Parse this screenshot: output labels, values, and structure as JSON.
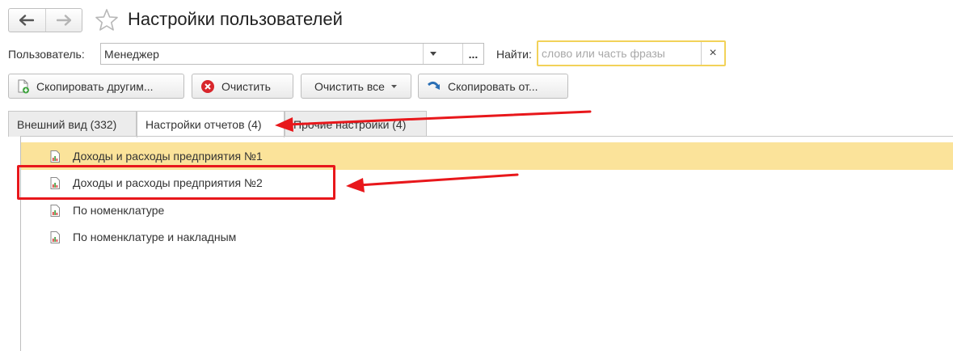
{
  "window": {
    "title": "Настройки пользователей"
  },
  "nav": {
    "back_icon": "arrow-left-icon",
    "forward_icon": "arrow-right-icon",
    "favorite_icon": "star-icon"
  },
  "user_field": {
    "label": "Пользователь:",
    "value": "Менеджер",
    "more_label": "..."
  },
  "search": {
    "label": "Найти:",
    "placeholder": "слово или часть фразы",
    "clear_label": "×"
  },
  "toolbar": {
    "copy_to_others": "Скопировать другим...",
    "clear": "Очистить",
    "clear_all": "Очистить все",
    "copy_from": "Скопировать от..."
  },
  "tabs": [
    {
      "label": "Внешний вид (332)"
    },
    {
      "label": "Настройки отчетов (4)"
    },
    {
      "label": "Прочие настройки (4)"
    }
  ],
  "reports": [
    {
      "label": "Доходы и расходы предприятия №1",
      "selected": true
    },
    {
      "label": "Доходы и расходы предприятия №2",
      "selected": false
    },
    {
      "label": "По номенклатуре",
      "selected": false
    },
    {
      "label": "По номенклатуре и накладным",
      "selected": false
    }
  ],
  "colors": {
    "selection": "#fbe39a",
    "annotation": "#e8171b",
    "search_border": "#f2d259"
  }
}
